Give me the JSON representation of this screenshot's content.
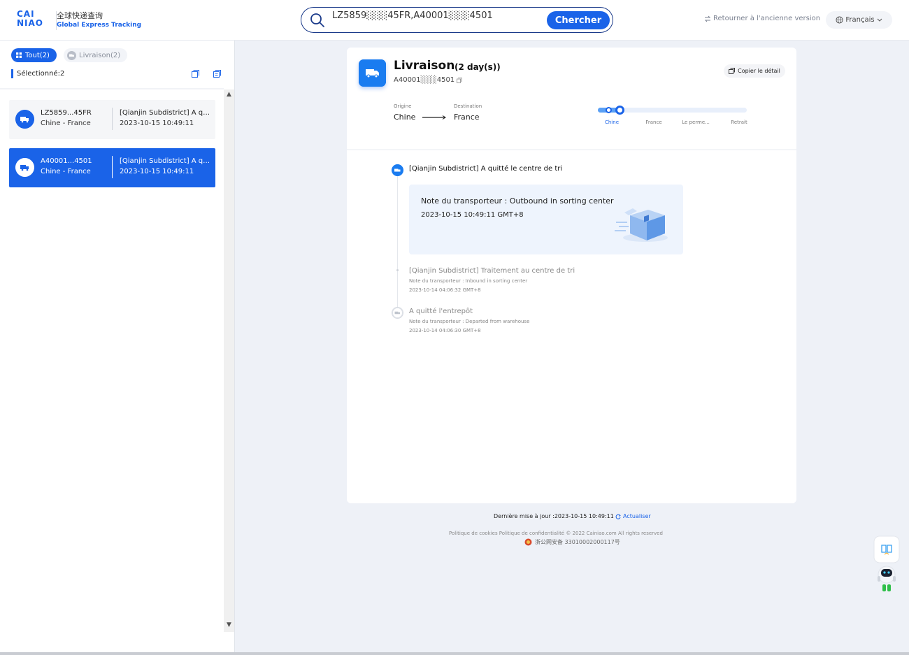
{
  "header": {
    "logo_mark": "CAI NIAO",
    "logo_cn": "全球快递查询",
    "logo_en": "Global Express Tracking",
    "search_value": "LZ5859░░░45FR,A40001░░░4501",
    "search_button": "Chercher",
    "old_version": "Retourner à l'ancienne version",
    "language": "Français"
  },
  "sidebar": {
    "filter_all": "Tout(2)",
    "filter_delivery": "Livraison(2)",
    "selected": "Sélectionné:2",
    "cards": [
      {
        "number": "LZ5859...45FR",
        "route": "Chine - France",
        "status": "[Qianjin Subdistrict] A quitté le centre de tri",
        "time": "2023-10-15 10:49:11"
      },
      {
        "number": "A40001...4501",
        "route": "Chine - France",
        "status": "[Qianjin Subdistrict] A quitté le centre de tri",
        "time": "2023-10-15 10:49:11"
      }
    ]
  },
  "detail": {
    "title": "Livraison",
    "days": "(2 day(s))",
    "tracking_number": "A40001░░░4501",
    "copy_detail": "Copier le détail",
    "origin_label": "Origine",
    "origin": "Chine",
    "destination_label": "Destination",
    "destination": "France",
    "progress_fraction": 0.15,
    "stages": [
      "Chine",
      "France",
      "Le perme...",
      "Retrait"
    ],
    "events": [
      {
        "title": "[Qianjin Subdistrict] A quitté le centre de tri",
        "note": "Note du transporteur : Outbound in sorting center",
        "time": "2023-10-15 10:49:11 GMT+8"
      },
      {
        "title": "[Qianjin Subdistrict] Traitement au centre de tri",
        "note": "Note du transporteur : Inbound in sorting center",
        "time": "2023-10-14 04:06:32 GMT+8"
      },
      {
        "title": "A quitté l'entrepôt",
        "note": "Note du transporteur : Departed from warehouse",
        "time": "2023-10-14 04:06:30 GMT+8"
      }
    ]
  },
  "footer": {
    "last_update": "Dernière mise à jour :2023-10-15 10:49:11",
    "refresh": "Actualiser",
    "links": "Politique de cookies   Politique de confidentialité   ©   2022   Cainiao.com   All rights reserved",
    "icp": "浙公网安备 33010002000117号"
  },
  "colors": {
    "primary": "#1a63e8",
    "background": "#eef1f7"
  }
}
